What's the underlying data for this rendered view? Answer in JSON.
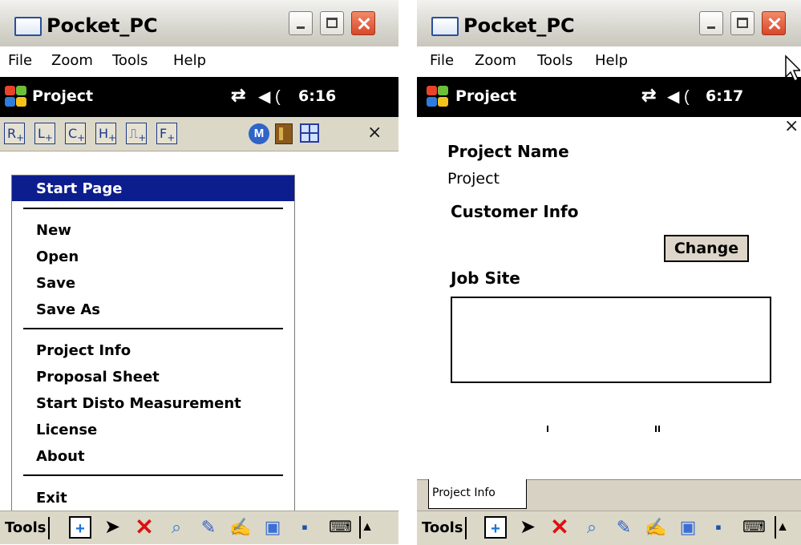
{
  "left": {
    "window_title": "Pocket_PC",
    "menu": [
      "File",
      "Zoom",
      "Tools",
      "Help"
    ],
    "header": {
      "title": "Project",
      "time": "6:16"
    },
    "draw_tools": [
      {
        "letter": "R",
        "sub": "+"
      },
      {
        "letter": "L",
        "sub": "+"
      },
      {
        "letter": "C",
        "sub": "+"
      },
      {
        "letter": "H",
        "sub": "+"
      },
      {
        "letter": "⎍",
        "sub": "+"
      },
      {
        "letter": "F",
        "sub": "+"
      }
    ],
    "m_tool": "M",
    "close_x": "×",
    "start_menu": {
      "highlighted": "Start Page",
      "group1": [
        "New",
        "Open",
        "Save",
        "Save As"
      ],
      "group2": [
        "Project Info",
        "Proposal Sheet",
        "Start Disto Measurement",
        "License",
        "About"
      ],
      "exit": "Exit"
    },
    "bottom_tools_label": "Tools"
  },
  "right": {
    "window_title": "Pocket_PC",
    "menu": [
      "File",
      "Zoom",
      "Tools",
      "Help"
    ],
    "header": {
      "title": "Project",
      "time": "6:17"
    },
    "close_x": "×",
    "project_name_label": "Project Name",
    "project_name_value": "Project",
    "customer_info_label": "Customer Info",
    "change_button": "Change",
    "job_site_label": "Job Site",
    "tab_label": "Project Info",
    "bottom_tools_label": "Tools"
  },
  "colors": {
    "menu_highlight": "#0c1d8e",
    "header_bg": "#000000",
    "toolbar_bg": "#dcd8c8",
    "close_button": "#d9472a"
  },
  "icons": {
    "bottom_bar": [
      "plus-icon",
      "pointer-icon",
      "delete-icon",
      "search-icon",
      "pen-icon",
      "note-icon",
      "window-icon",
      "save-icon",
      "keyboard-icon",
      "up-arrow-icon"
    ]
  }
}
